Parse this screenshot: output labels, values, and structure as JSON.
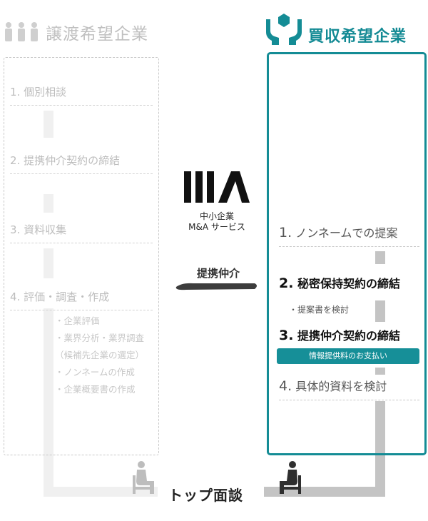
{
  "seller": {
    "icon": "people-group-icon",
    "title": "譲渡希望企業",
    "steps": [
      "1. 個別相談",
      "2. 提携仲介契約の締結",
      "3. 資料収集",
      "4. 評価・調査・作成"
    ],
    "substeps": [
      "・企業評価",
      "・業界分析・業界調査",
      "（候補先企業の選定）",
      "・ノンネームの作成",
      "・企業概要書の作成"
    ]
  },
  "buyer": {
    "icon": "hands-holding-box-icon",
    "title": "買収希望企業",
    "steps": [
      {
        "num": "1.",
        "label": "ノンネームでの提案"
      },
      {
        "num": "2.",
        "label": "秘密保持契約の締結"
      },
      {
        "num": "3.",
        "label": "提携仲介契約の締結"
      },
      {
        "num": "4.",
        "label": "具体的資料を検討"
      }
    ],
    "substep": "・提案書を検討",
    "info_bar": "情報提供料のお支払い"
  },
  "center": {
    "logo_icon": "ma-logo-icon",
    "caption_line1": "中小企業",
    "caption_line2": "M&A サービス",
    "intermediary": "提携仲介"
  },
  "meeting": {
    "icon": "seated-person-icon",
    "label": "トップ面談"
  },
  "colors": {
    "accent": "#148c95",
    "muted_text": "#bdbdbd",
    "light_connector": "#f0f0f0",
    "dark_connector": "#c4c4c4"
  }
}
